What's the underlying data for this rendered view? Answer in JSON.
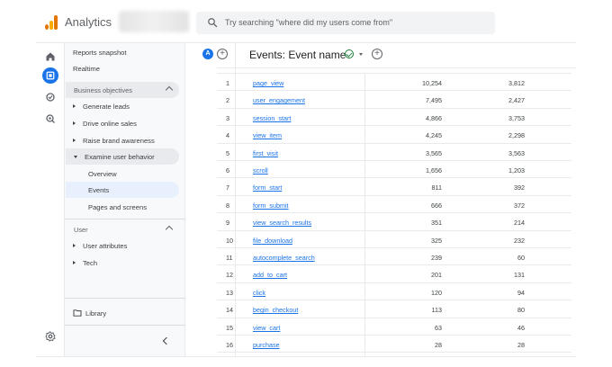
{
  "header": {
    "app_title": "Analytics",
    "search_placeholder": "Try searching \"where did my users come from\""
  },
  "rail": {
    "icons": [
      "home-icon",
      "reports-icon",
      "explore-icon",
      "advertising-icon",
      "settings-icon"
    ],
    "active": "reports-icon"
  },
  "nav": {
    "reports_snapshot": "Reports snapshot",
    "realtime": "Realtime",
    "business_objectives": "Business objectives",
    "generate_leads": "Generate leads",
    "drive_online_sales": "Drive online sales",
    "raise_brand_awareness": "Raise brand awareness",
    "examine_user_behavior": "Examine user behavior",
    "overview": "Overview",
    "events": "Events",
    "pages_and_screens": "Pages and screens",
    "user_section": "User",
    "user_attributes": "User attributes",
    "tech": "Tech",
    "library": "Library"
  },
  "report": {
    "comparison_badge": "A",
    "title": "Events: Event name",
    "accent_color": "#1a73e8",
    "link_color": "#1a73e8",
    "rows": [
      {
        "idx": "1",
        "event": "page_view",
        "v1": "10,254",
        "v2": "3,812"
      },
      {
        "idx": "2",
        "event": "user_engagement",
        "v1": "7,495",
        "v2": "2,427"
      },
      {
        "idx": "3",
        "event": "session_start",
        "v1": "4,866",
        "v2": "3,753"
      },
      {
        "idx": "4",
        "event": "view_item",
        "v1": "4,245",
        "v2": "2,298"
      },
      {
        "idx": "5",
        "event": "first_visit",
        "v1": "3,565",
        "v2": "3,563"
      },
      {
        "idx": "6",
        "event": "scroll",
        "v1": "1,656",
        "v2": "1,203"
      },
      {
        "idx": "7",
        "event": "form_start",
        "v1": "811",
        "v2": "392"
      },
      {
        "idx": "8",
        "event": "form_submit",
        "v1": "666",
        "v2": "372"
      },
      {
        "idx": "9",
        "event": "view_search_results",
        "v1": "351",
        "v2": "214"
      },
      {
        "idx": "10",
        "event": "file_download",
        "v1": "325",
        "v2": "232"
      },
      {
        "idx": "11",
        "event": "autocomplete_search",
        "v1": "239",
        "v2": "60"
      },
      {
        "idx": "12",
        "event": "add_to_cart",
        "v1": "201",
        "v2": "131"
      },
      {
        "idx": "13",
        "event": "click",
        "v1": "120",
        "v2": "94"
      },
      {
        "idx": "14",
        "event": "begin_checkout",
        "v1": "113",
        "v2": "80"
      },
      {
        "idx": "15",
        "event": "view_cart",
        "v1": "63",
        "v2": "46"
      },
      {
        "idx": "16",
        "event": "purchase",
        "v1": "28",
        "v2": "28"
      }
    ]
  }
}
